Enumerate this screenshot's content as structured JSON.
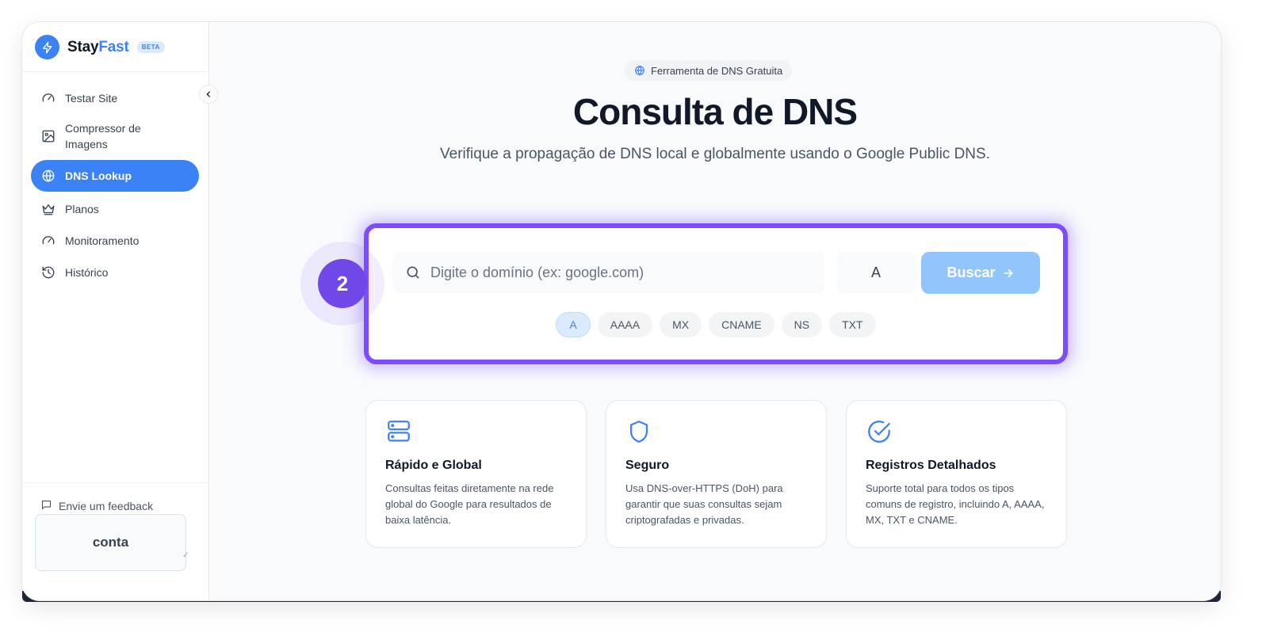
{
  "brand": {
    "name_part1": "Stay",
    "name_part2": "Fast",
    "badge": "BETA"
  },
  "sidebar": {
    "items": [
      {
        "label": "Testar Site",
        "icon": "gauge-icon"
      },
      {
        "label": "Compressor de Imagens",
        "icon": "image-icon"
      },
      {
        "label": "DNS Lookup",
        "icon": "globe-icon",
        "active": true
      },
      {
        "label": "Planos",
        "icon": "crown-icon"
      },
      {
        "label": "Monitoramento",
        "icon": "gauge-icon"
      },
      {
        "label": "Histórico",
        "icon": "history-icon"
      }
    ],
    "feedback_label": "Envie um feedback",
    "account_label": "conta"
  },
  "main": {
    "pill_label": "Ferramenta de DNS Gratuita",
    "title": "Consulta de DNS",
    "subtitle": "Verifique a propagação de DNS local e globalmente usando o Google Public DNS.",
    "search": {
      "placeholder": "Digite o domínio (ex: google.com)",
      "value": "",
      "record_type": "A",
      "button_label": "Buscar"
    },
    "step_number": "2",
    "record_chips": [
      "A",
      "AAAA",
      "MX",
      "CNAME",
      "NS",
      "TXT"
    ],
    "active_chip": "A",
    "features": [
      {
        "title": "Rápido e Global",
        "text": "Consultas feitas diretamente na rede global do Google para resultados de baixa latência.",
        "icon": "server-icon"
      },
      {
        "title": "Seguro",
        "text": "Usa DNS-over-HTTPS (DoH) para garantir que suas consultas sejam criptografadas e privadas.",
        "icon": "shield-icon"
      },
      {
        "title": "Registros Detalhados",
        "text": "Suporte total para todos os tipos comuns de registro, incluindo A, AAAA, MX, TXT e CNAME.",
        "icon": "check-circle-icon"
      }
    ]
  },
  "colors": {
    "accent": "#3b82f6",
    "highlight": "#7c4dff",
    "button_disabled": "#93c5fd"
  }
}
